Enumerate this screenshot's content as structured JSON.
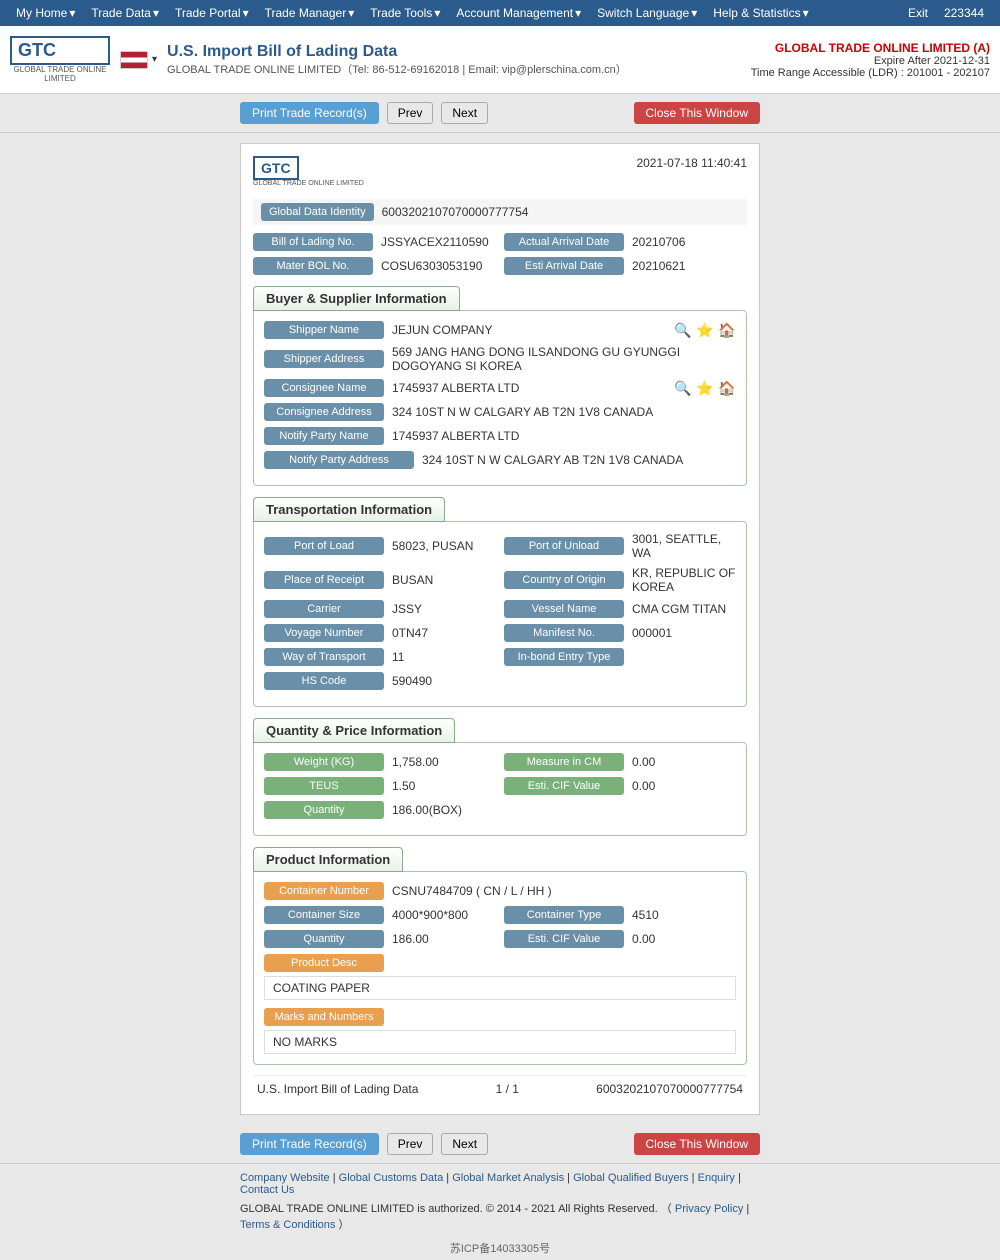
{
  "nav": {
    "items": [
      "My Home",
      "Trade Data",
      "Trade Portal",
      "Trade Manager",
      "Trade Tools",
      "Account Management",
      "Switch Language",
      "Help & Statistics",
      "Exit"
    ],
    "user_id": "223344"
  },
  "header": {
    "logo_text": "GTC",
    "logo_sub": "GLOBAL TRADE ONLINE LIMITED",
    "title": "U.S. Import Bill of Lading Data",
    "subtitle": "GLOBAL TRADE ONLINE LIMITED（Tel: 86-512-69162018 | Email: vip@plerschina.com.cn）",
    "company_name": "GLOBAL TRADE ONLINE LIMITED (A)",
    "expire": "Expire After 2021-12-31",
    "time_range": "Time Range Accessible (LDR) : 201001 - 202107"
  },
  "toolbar": {
    "print_label": "Print Trade Record(s)",
    "prev_label": "Prev",
    "next_label": "Next",
    "close_label": "Close This Window"
  },
  "record": {
    "timestamp": "2021-07-18 11:40:41",
    "global_data_identity_label": "Global Data Identity",
    "global_data_identity_value": "6003202107070000777754",
    "bol_no_label": "Bill of Lading No.",
    "bol_no_value": "JSSYACEX2110590",
    "actual_arrival_date_label": "Actual Arrival Date",
    "actual_arrival_date_value": "20210706",
    "master_bol_label": "Mater BOL No.",
    "master_bol_value": "COSU6303053190",
    "esti_arrival_label": "Esti Arrival Date",
    "esti_arrival_value": "20210621",
    "sections": {
      "buyer_supplier": {
        "title": "Buyer & Supplier Information",
        "fields": [
          {
            "label": "Shipper Name",
            "value": "JEJUN COMPANY",
            "has_icons": true
          },
          {
            "label": "Shipper Address",
            "value": "569 JANG HANG DONG ILSANDONG GU GYUNGGI DOGOYANG SI KOREA",
            "has_icons": false
          },
          {
            "label": "Consignee Name",
            "value": "1745937 ALBERTA LTD",
            "has_icons": true
          },
          {
            "label": "Consignee Address",
            "value": "324 10ST N W CALGARY AB T2N 1V8 CANADA",
            "has_icons": false
          },
          {
            "label": "Notify Party Name",
            "value": "1745937 ALBERTA LTD",
            "has_icons": false
          },
          {
            "label": "Notify Party Address",
            "value": "324 10ST N W CALGARY AB T2N 1V8 CANADA",
            "has_icons": false
          }
        ]
      },
      "transportation": {
        "title": "Transportation Information",
        "fields_left": [
          {
            "label": "Port of Load",
            "value": "58023, PUSAN"
          },
          {
            "label": "Place of Receipt",
            "value": "BUSAN"
          },
          {
            "label": "Carrier",
            "value": "JSSY"
          },
          {
            "label": "Voyage Number",
            "value": "0TN47"
          },
          {
            "label": "Way of Transport",
            "value": "11"
          },
          {
            "label": "HS Code",
            "value": "590490"
          }
        ],
        "fields_right": [
          {
            "label": "Port of Unload",
            "value": "3001, SEATTLE, WA"
          },
          {
            "label": "Country of Origin",
            "value": "KR, REPUBLIC OF KOREA"
          },
          {
            "label": "Vessel Name",
            "value": "CMA CGM TITAN"
          },
          {
            "label": "Manifest No.",
            "value": "000001"
          },
          {
            "label": "In-bond Entry Type",
            "value": ""
          }
        ]
      },
      "quantity": {
        "title": "Quantity & Price Information",
        "fields": [
          {
            "label_left": "Weight (KG)",
            "value_left": "1,758.00",
            "label_right": "Measure in CM",
            "value_right": "0.00"
          },
          {
            "label_left": "TEUS",
            "value_left": "1.50",
            "label_right": "Esti. CIF Value",
            "value_right": "0.00"
          },
          {
            "label_left": "Quantity",
            "value_left": "186.00(BOX)",
            "label_right": "",
            "value_right": ""
          }
        ]
      },
      "product": {
        "title": "Product Information",
        "container_number_label": "Container Number",
        "container_number_value": "CSNU7484709 ( CN / L / HH )",
        "container_size_label": "Container Size",
        "container_size_value": "4000*900*800",
        "container_type_label": "Container Type",
        "container_type_value": "4510",
        "quantity_label": "Quantity",
        "quantity_value": "186.00",
        "esti_cif_label": "Esti. CIF Value",
        "esti_cif_value": "0.00",
        "product_desc_label": "Product Desc",
        "product_desc_value": "COATING PAPER",
        "marks_label": "Marks and Numbers",
        "marks_value": "NO MARKS"
      }
    },
    "footer": {
      "page_label": "U.S. Import Bill of Lading Data",
      "page_num": "1 / 1",
      "record_id": "6003202107070000777754"
    }
  },
  "footer": {
    "icp": "苏ICP备14033305号",
    "links": [
      "Company Website",
      "Global Customs Data",
      "Global Market Analysis",
      "Global Qualified Buyers",
      "Enquiry",
      "Contact Us"
    ],
    "copyright": "GLOBAL TRADE ONLINE LIMITED is authorized. © 2014 - 2021 All Rights Reserved.",
    "privacy_label": "Privacy Policy",
    "terms_label": "Terms & Conditions"
  }
}
